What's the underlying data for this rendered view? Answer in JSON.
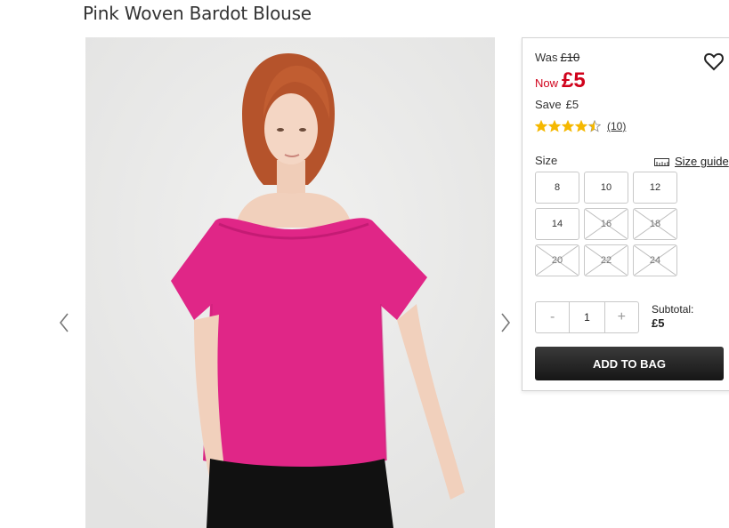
{
  "product": {
    "title": "Pink Woven Bardot Blouse"
  },
  "gallery": {
    "image": "model-in-pink-off-shoulder-blouse",
    "prev_icon": "chevron-left-icon",
    "next_icon": "chevron-right-icon"
  },
  "price": {
    "was_label": "Was",
    "was_value": "£10",
    "now_label": "Now",
    "now_value": "£5",
    "save_label": "Save",
    "save_value": "£5",
    "sale_color": "#d0021b"
  },
  "wishlist": {
    "icon": "heart-icon"
  },
  "rating": {
    "stars": 4.5,
    "max": 5,
    "count": "(10)",
    "star_color": "#f5b800"
  },
  "size": {
    "label": "Size",
    "guide_label": "Size guide",
    "guide_icon": "ruler-icon",
    "options": [
      {
        "label": "8",
        "available": true
      },
      {
        "label": "10",
        "available": true
      },
      {
        "label": "12",
        "available": true
      },
      {
        "label": "14",
        "available": true
      },
      {
        "label": "16",
        "available": false
      },
      {
        "label": "18",
        "available": false
      },
      {
        "label": "20",
        "available": false
      },
      {
        "label": "22",
        "available": false
      },
      {
        "label": "24",
        "available": false
      }
    ]
  },
  "quantity": {
    "minus": "-",
    "value": "1",
    "plus": "+"
  },
  "subtotal": {
    "label": "Subtotal:",
    "value": "£5"
  },
  "cta": {
    "add_to_bag": "ADD TO BAG"
  }
}
